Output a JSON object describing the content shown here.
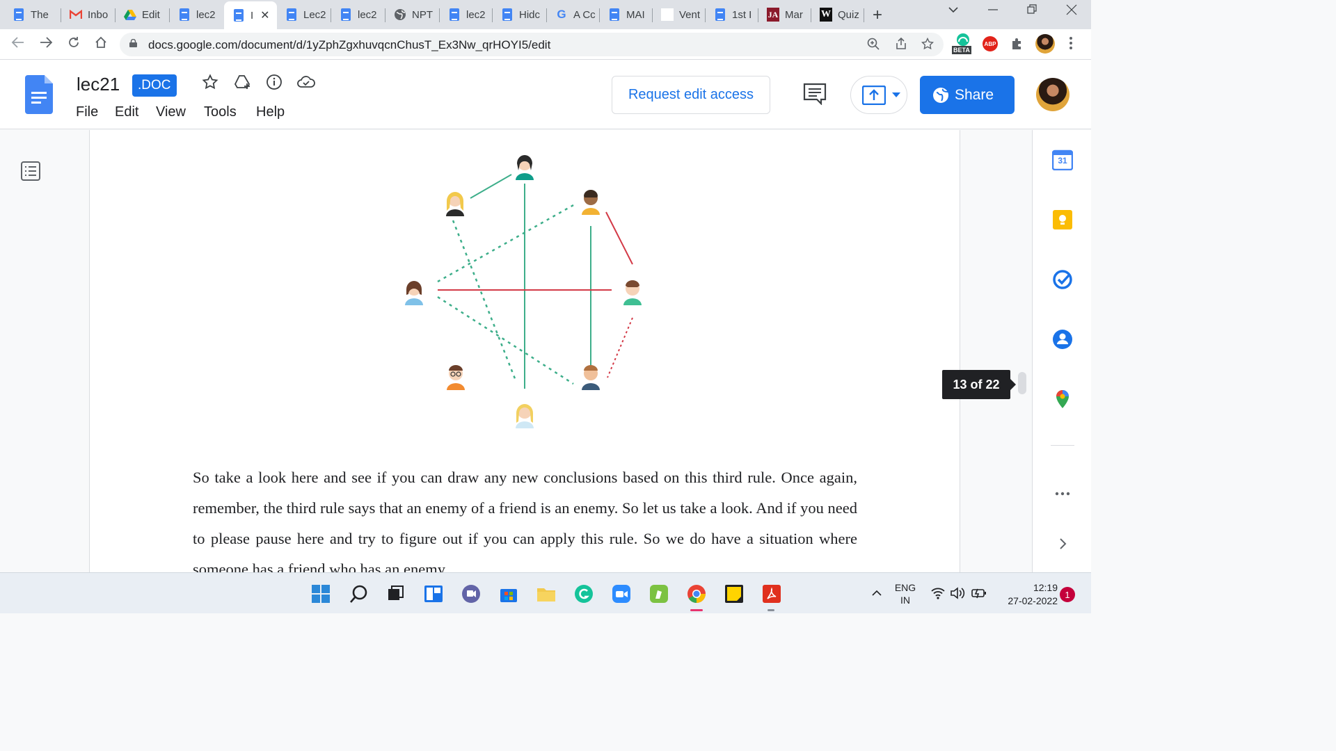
{
  "browser": {
    "tabs": [
      {
        "label": "The",
        "icon": "docs-icon"
      },
      {
        "label": "Inbo",
        "icon": "gmail-icon"
      },
      {
        "label": "Edit",
        "icon": "drive-icon"
      },
      {
        "label": "lec2",
        "icon": "docs-icon"
      },
      {
        "label": "I",
        "icon": "docs-icon",
        "active": true
      },
      {
        "label": "Lec2",
        "icon": "docs-icon"
      },
      {
        "label": "lec2",
        "icon": "docs-icon"
      },
      {
        "label": "NPT",
        "icon": "globe-icon"
      },
      {
        "label": "lec2",
        "icon": "docs-icon"
      },
      {
        "label": "Hidc",
        "icon": "docs-icon"
      },
      {
        "label": "A Cc",
        "icon": "google-icon"
      },
      {
        "label": "MAI",
        "icon": "docs-icon"
      },
      {
        "label": "Vent",
        "icon": "blank-icon"
      },
      {
        "label": "1st I",
        "icon": "docs-icon"
      },
      {
        "label": "Mar",
        "icon": "ja-icon"
      },
      {
        "label": "Quiz",
        "icon": "w-icon"
      }
    ],
    "url": "docs.google.com/document/d/1yZphZgxhuvqcnChusT_Ex3Nw_qrHOYI5/edit",
    "extension_badge": "BETA",
    "abp_label": "ABP"
  },
  "docs": {
    "title": "lec21",
    "badge": ".DOC",
    "menu": [
      "File",
      "Edit",
      "View",
      "Tools",
      "Help"
    ],
    "request_edit": "Request edit access",
    "share": "Share",
    "page_indicator": "13 of 22",
    "body_text": "So take a look here and see if you can draw any new conclusions based on this third rule. Once again, remember, the third rule says that an enemy of a friend is an enemy. So let us take a look. And if you need to please pause here and try to figure out if you can apply this rule. So we do have a situation where someone has a friend who has an enemy."
  },
  "side_panel": {
    "calendar_day": "31"
  },
  "taskbar": {
    "lang_line1": "ENG",
    "lang_line2": "IN",
    "time": "12:19",
    "date": "27-02-2022",
    "notification_count": "1"
  },
  "colors": {
    "friend_edge": "#3dae8a",
    "enemy_edge": "#d33a47",
    "accent": "#1a73e8"
  }
}
